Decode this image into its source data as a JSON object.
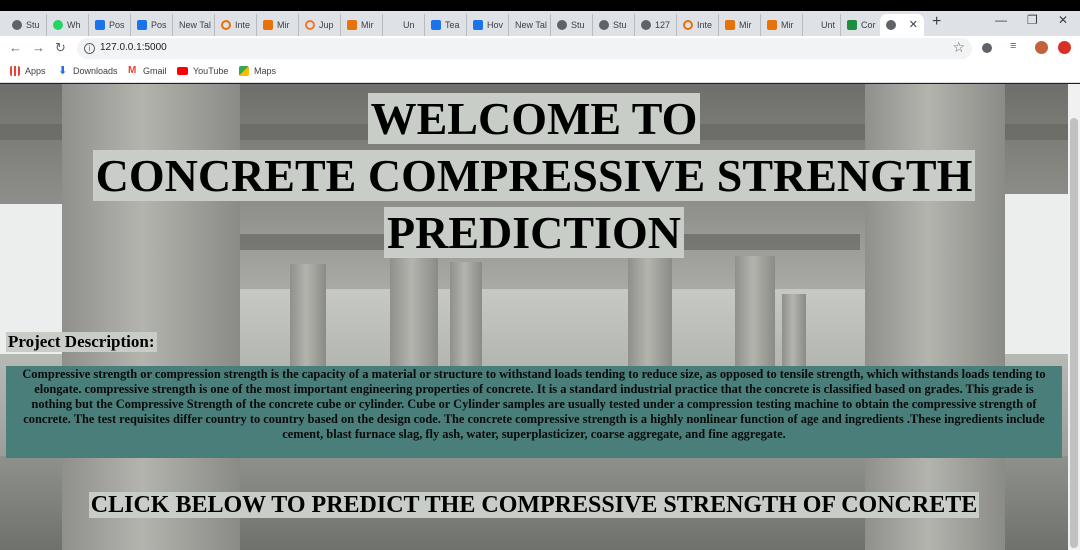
{
  "tabs": [
    {
      "label": "Stu",
      "favicon": "globe-icon",
      "color": "#5f6368"
    },
    {
      "label": "Wh",
      "favicon": "whatsapp-icon",
      "color": "#25d366"
    },
    {
      "label": "Pos",
      "favicon": "meet-icon",
      "color": "#1a73e8"
    },
    {
      "label": "Pos",
      "favicon": "meet-icon",
      "color": "#1a73e8"
    },
    {
      "label": "New Tal",
      "favicon": "",
      "color": ""
    },
    {
      "label": "Inte",
      "favicon": "loading-icon",
      "color": "#e8710a"
    },
    {
      "label": "Mir",
      "favicon": "doc-icon",
      "color": "#e8710a"
    },
    {
      "label": "Jup",
      "favicon": "jupyter-icon",
      "color": "#f37726"
    },
    {
      "label": "Mir",
      "favicon": "doc-icon",
      "color": "#e8710a"
    },
    {
      "label": "Un",
      "favicon": "",
      "color": ""
    },
    {
      "label": "Tea",
      "favicon": "teams-icon",
      "color": "#1a73e8"
    },
    {
      "label": "Hov",
      "favicon": "meet-icon",
      "color": "#1a73e8"
    },
    {
      "label": "New Tal",
      "favicon": "",
      "color": ""
    },
    {
      "label": "Stu",
      "favicon": "globe-icon",
      "color": "#5f6368"
    },
    {
      "label": "Stu",
      "favicon": "globe-icon",
      "color": "#5f6368"
    },
    {
      "label": "127",
      "favicon": "globe-icon",
      "color": "#5f6368"
    },
    {
      "label": "Inte",
      "favicon": "loading-icon",
      "color": "#e8710a"
    },
    {
      "label": "Mir",
      "favicon": "doc-icon",
      "color": "#e8710a"
    },
    {
      "label": "Mir",
      "favicon": "doc-icon",
      "color": "#e8710a"
    },
    {
      "label": "Unt",
      "favicon": "",
      "color": ""
    },
    {
      "label": "Cor",
      "favicon": "sheet-icon",
      "color": "#1e8e3e"
    },
    {
      "label": "",
      "favicon": "globe-icon",
      "color": "#5f6368",
      "active": true
    }
  ],
  "toolbar": {
    "url": "127.0.0.1:5000"
  },
  "bookmarks": [
    {
      "label": "Apps",
      "icon": "apps-grid-icon",
      "color": "#ea4335"
    },
    {
      "label": "Downloads",
      "icon": "download-icon",
      "color": "#1a73e8"
    },
    {
      "label": "Gmail",
      "icon": "gmail-icon",
      "color": "#ea4335"
    },
    {
      "label": "YouTube",
      "icon": "youtube-icon",
      "color": "#ff0000"
    },
    {
      "label": "Maps",
      "icon": "maps-icon",
      "color": "#34a853"
    }
  ],
  "page": {
    "title_line1": "WELCOME TO",
    "title_line2": "CONCRETE COMPRESSIVE STRENGTH",
    "title_line3": "PREDICTION",
    "description_heading": "Project Description:",
    "description": "Compressive strength or compression strength is the capacity of a material or structure to withstand loads tending to reduce size, as opposed to tensile strength, which withstands loads tending to elongate. compressive strength is one of the most important engineering properties of concrete. It is a standard industrial practice that the concrete is classified based on grades. This grade is nothing but the Compressive Strength of the concrete cube or cylinder. Cube or Cylinder samples are usually tested under a compression testing machine to obtain the compressive strength of concrete. The test requisites differ country to country based on the design code. The concrete compressive strength is a highly nonlinear function of age and ingredients .These ingredients include cement, blast furnace slag, fly ash, water, superplasticizer, coarse aggregate, and fine aggregate.",
    "cta": "CLICK BELOW TO PREDICT THE COMPRESSIVE STRENGTH OF CONCRETE"
  },
  "colors": {
    "description_bg": "#4a7e7a",
    "title_bg": "#c8cdc8"
  }
}
